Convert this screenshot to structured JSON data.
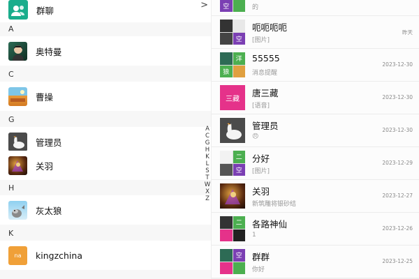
{
  "contacts": {
    "group_label": "群聊",
    "group_chevron": ">",
    "sections": [
      {
        "letter": "A",
        "items": [
          {
            "name": "奥特曼"
          }
        ]
      },
      {
        "letter": "C",
        "items": [
          {
            "name": "曹操"
          }
        ]
      },
      {
        "letter": "G",
        "items": [
          {
            "name": "管理员"
          },
          {
            "name": "关羽"
          }
        ]
      },
      {
        "letter": "H",
        "items": [
          {
            "name": "灰太狼"
          }
        ]
      },
      {
        "letter": "K",
        "items": [
          {
            "name": "kingzchina"
          }
        ]
      }
    ],
    "index_letters": [
      "A",
      "C",
      "G",
      "H",
      "K",
      "L",
      "S",
      "T",
      "W",
      "X",
      "Z"
    ],
    "kingz_avatar_text": "na"
  },
  "chats": [
    {
      "title": "",
      "preview": "的",
      "time": ""
    },
    {
      "title": "呃呃呃呃",
      "preview": "[图片]",
      "time": "昨天"
    },
    {
      "title": "55555",
      "preview": "消息提醒",
      "time": "2023-12-30"
    },
    {
      "title": "唐三藏",
      "preview": "[语音]",
      "time": "2023-12-30"
    },
    {
      "title": "管理员",
      "preview": "😠",
      "time": "2023-12-30"
    },
    {
      "title": "分好",
      "preview": "[图片]",
      "time": "2023-12-29"
    },
    {
      "title": "关羽",
      "preview": "新筑雕将银砂结",
      "time": "2023-12-27"
    },
    {
      "title": "各路神仙",
      "preview": "1",
      "time": "2023-12-26"
    },
    {
      "title": "群群",
      "preview": "你好",
      "time": "2023-12-25"
    }
  ],
  "avatar_texts": {
    "sanzang": "三藏",
    "yang": "洋",
    "lang": "狼",
    "kong": "空",
    "er": "二"
  },
  "colors": {
    "accent_green": "#1aad8c",
    "sanzang_pink": "#e5328a",
    "yang_green": "#4caf50",
    "purple": "#7b3fb3",
    "orange": "#f0a038"
  }
}
